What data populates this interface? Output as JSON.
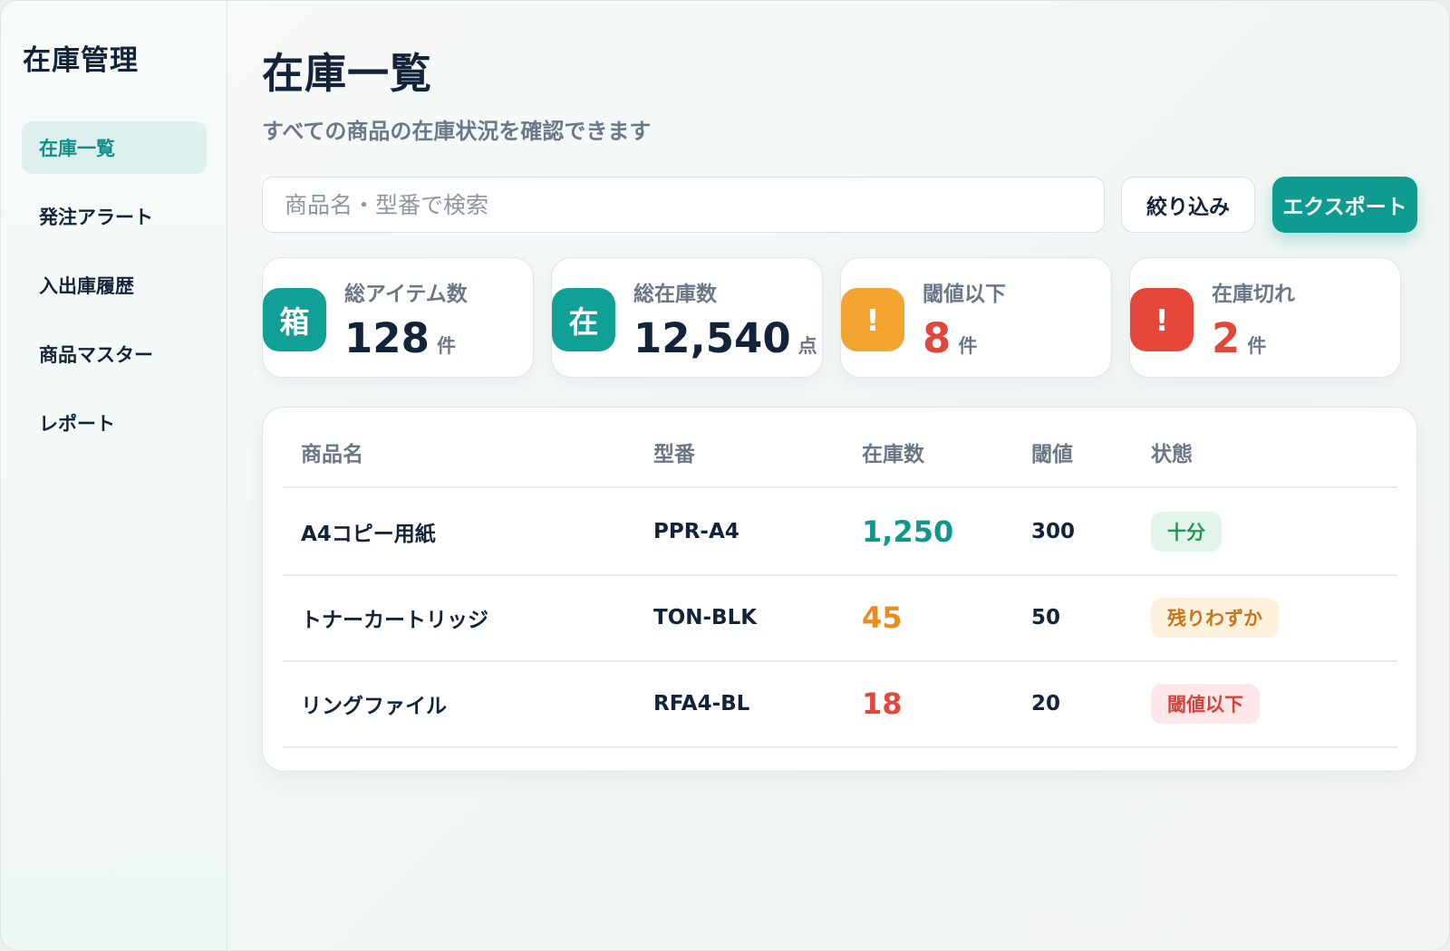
{
  "sidebar": {
    "logo": "在庫管理",
    "items": [
      {
        "label": "在庫一覧",
        "active": true
      },
      {
        "label": "発注アラート",
        "active": false
      },
      {
        "label": "入出庫履歴",
        "active": false
      },
      {
        "label": "商品マスター",
        "active": false
      },
      {
        "label": "レポート",
        "active": false
      }
    ]
  },
  "header": {
    "title": "在庫一覧",
    "subtitle": "すべての商品の在庫状況を確認できます"
  },
  "toolbar": {
    "search_placeholder": "商品名・型番で検索",
    "filter_label": "絞り込み",
    "export_label": "エクスポート"
  },
  "stats": [
    {
      "badge": "箱",
      "label": "総アイテム数",
      "value": "128",
      "unit": "件",
      "badge_color": "#11a095",
      "value_color": "#13243a"
    },
    {
      "badge": "在",
      "label": "総在庫数",
      "value": "12,540",
      "unit": "点",
      "badge_color": "#11a095",
      "value_color": "#13243a"
    },
    {
      "badge": "!",
      "label": "閾値以下",
      "value": "8",
      "unit": "件",
      "badge_color": "#f3a431",
      "value_color": "#e0483b"
    },
    {
      "badge": "!",
      "label": "在庫切れ",
      "value": "2",
      "unit": "件",
      "badge_color": "#e5483b",
      "value_color": "#e0483b"
    }
  ],
  "table": {
    "columns": [
      "商品名",
      "型番",
      "在庫数",
      "閾値",
      "状態"
    ],
    "rows": [
      {
        "name": "A4コピー用紙",
        "sku": "PPR-A4",
        "qty": "1,250",
        "threshold": "300",
        "status": "十分",
        "qty_color": "#0f978c",
        "status_bg": "#e3f5eb",
        "status_color": "#1f9a56"
      },
      {
        "name": "トナーカートリッジ",
        "sku": "TON-BLK",
        "qty": "45",
        "threshold": "50",
        "status": "残りわずか",
        "qty_color": "#ec8a1c",
        "status_bg": "#fff1dc",
        "status_color": "#c9761a"
      },
      {
        "name": "リングファイル",
        "sku": "RFA4-BL",
        "qty": "18",
        "threshold": "20",
        "status": "閾値以下",
        "qty_color": "#e0483b",
        "status_bg": "#fde7e8",
        "status_color": "#d8403a"
      }
    ]
  }
}
